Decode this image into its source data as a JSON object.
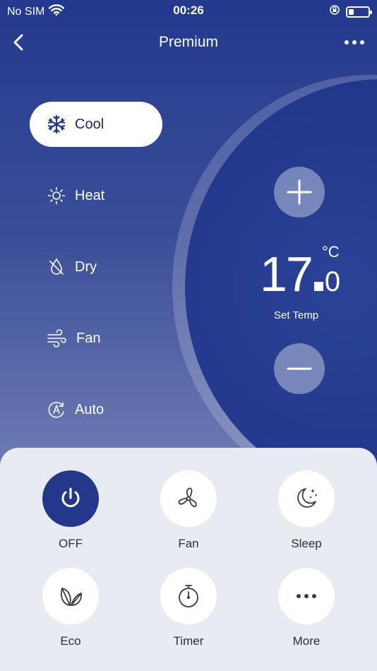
{
  "status_bar": {
    "carrier": "No SIM",
    "time": "00:26"
  },
  "nav": {
    "title": "Premium"
  },
  "modes": [
    {
      "label": "Cool",
      "icon": "snowflake-icon",
      "selected": true
    },
    {
      "label": "Heat",
      "icon": "sun-icon",
      "selected": false
    },
    {
      "label": "Dry",
      "icon": "droplet-icon",
      "selected": false
    },
    {
      "label": "Fan",
      "icon": "wind-icon",
      "selected": false
    },
    {
      "label": "Auto",
      "icon": "auto-icon",
      "selected": false
    }
  ],
  "temperature": {
    "integer": "17",
    "decimal": "0",
    "unit": "°C",
    "label": "Set Temp"
  },
  "controls": [
    {
      "label": "OFF",
      "icon": "power-icon",
      "active": true
    },
    {
      "label": "Fan",
      "icon": "fan-icon",
      "active": false
    },
    {
      "label": "Sleep",
      "icon": "moon-icon",
      "active": false
    },
    {
      "label": "Eco",
      "icon": "leaf-icon",
      "active": false
    },
    {
      "label": "Timer",
      "icon": "stopwatch-icon",
      "active": false
    },
    {
      "label": "More",
      "icon": "more-icon",
      "active": false
    }
  ],
  "colors": {
    "accent": "#25378a",
    "panel_bg": "#e9ebf3"
  }
}
